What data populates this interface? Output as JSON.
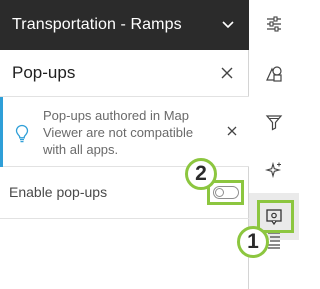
{
  "layer_header": {
    "title": "Transportation - Ramps",
    "chevron_icon": "chevron-down-icon"
  },
  "popups_panel": {
    "title": "Pop-ups",
    "close_icon": "close-icon"
  },
  "notice": {
    "text": "Pop-ups authored in Map Viewer are not compatible with all apps.",
    "icon": "lightbulb-icon",
    "accent": "#2f9fd8"
  },
  "enable_popups": {
    "label": "Enable pop-ups",
    "enabled": false
  },
  "callouts": {
    "one": "1",
    "two": "2",
    "color": "#8cc63f"
  },
  "toolbar": {
    "items": [
      {
        "icon": "properties-icon"
      },
      {
        "icon": "styles-icon"
      },
      {
        "icon": "filter-icon"
      },
      {
        "icon": "effects-icon"
      },
      {
        "icon": "popups-icon",
        "active": true
      },
      {
        "icon": "fields-icon"
      }
    ]
  }
}
